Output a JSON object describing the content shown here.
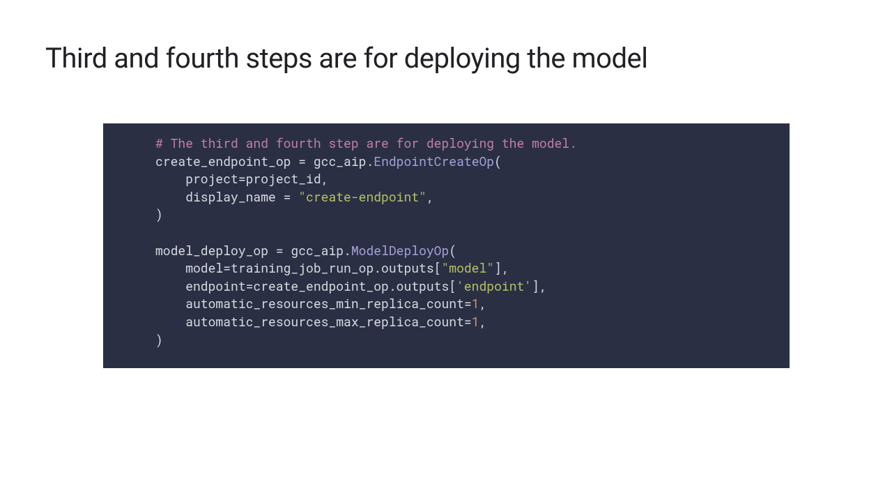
{
  "title": "Third and fourth steps are for deploying the model",
  "code": {
    "comment": "# The third and fourth step are for deploying the model.",
    "l2a": "create_endpoint_op = gcc_aip.",
    "l2b": "EndpointCreateOp",
    "l2c": "(",
    "l3": "    project=project_id,",
    "l4a": "    display_name = ",
    "l4b": "\"create-endpoint\"",
    "l4c": ",",
    "l5": ")",
    "blank": "",
    "l7a": "model_deploy_op = gcc_aip.",
    "l7b": "ModelDeployOp",
    "l7c": "(",
    "l8a": "    model=training_job_run_op.outputs[",
    "l8b": "\"model\"",
    "l8c": "],",
    "l9a": "    endpoint=create_endpoint_op.outputs[",
    "l9b": "'endpoint'",
    "l9c": "],",
    "l10a": "    automatic_resources_min_replica_count=",
    "l10b": "1",
    "l10c": ",",
    "l11a": "    automatic_resources_max_replica_count=",
    "l11b": "1",
    "l11c": ",",
    "l12": ")"
  }
}
